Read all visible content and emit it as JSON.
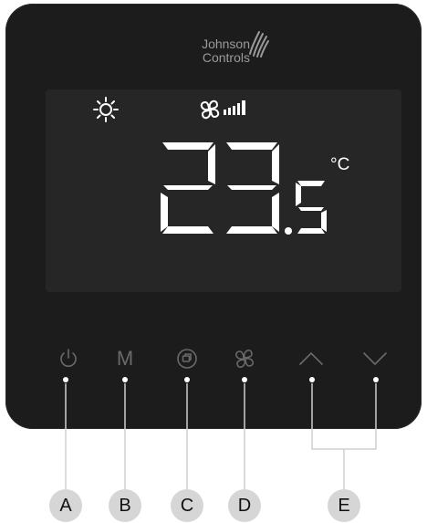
{
  "brand": {
    "line1": "Johnson",
    "line2": "Controls"
  },
  "display": {
    "temperature_whole": "23",
    "temperature_decimal": "5",
    "unit": "°C",
    "mode_icon": "sun-icon",
    "fan_icon": "fan-icon",
    "fan_speed_level": 1.0,
    "digit_color": "#ffffff",
    "screen_color": "#262626"
  },
  "buttons": {
    "power": {
      "icon": "power-icon"
    },
    "mode": {
      "label": "M"
    },
    "timer": {
      "icon": "timer-icon"
    },
    "fan": {
      "icon": "fan-icon"
    },
    "up": {
      "icon": "chevron-up-icon"
    },
    "down": {
      "icon": "chevron-down-icon"
    }
  },
  "callouts": [
    "A",
    "B",
    "C",
    "D",
    "E"
  ],
  "colors": {
    "bezel": "#1c1c1c",
    "button_icon": "#6a6a6a",
    "callout_bg": "#d6d6d6"
  }
}
